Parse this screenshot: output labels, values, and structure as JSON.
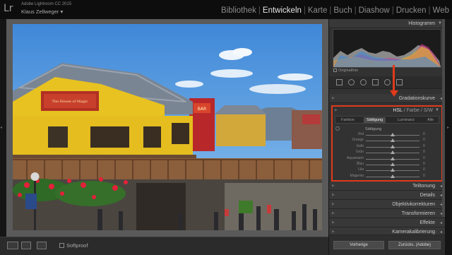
{
  "app": {
    "logo": "Lr",
    "name": "Adobe Lightroom CC 2015",
    "user": "Klaus Zellweger ▾"
  },
  "modules": [
    {
      "label": "Bibliothek",
      "active": false
    },
    {
      "label": "Entwickeln",
      "active": true
    },
    {
      "label": "Karte",
      "active": false
    },
    {
      "label": "Buch",
      "active": false
    },
    {
      "label": "Diashow",
      "active": false
    },
    {
      "label": "Drucken",
      "active": false
    },
    {
      "label": "Web",
      "active": false
    }
  ],
  "photo_signs": {
    "cafe": "The House of Magic",
    "bar": "BAR"
  },
  "toolbar": {
    "softproof_label": "Softproof"
  },
  "panels": {
    "histogram": {
      "title": "Histogramm",
      "info_left": "ISO 400",
      "info_right": "f/5",
      "original_photo_label": "Originalfoto"
    },
    "basic_title": "Gradationskurve",
    "hsl": {
      "tabs": [
        "HSL",
        "Farbe",
        "S/W"
      ],
      "subtabs": [
        "Farbton",
        "Sättigung",
        "Luminanz",
        "Alle"
      ],
      "active_subtab": "Sättigung",
      "section_label": "Sättigung",
      "rows": [
        {
          "name": "Rot",
          "value": "0"
        },
        {
          "name": "Orange",
          "value": "0"
        },
        {
          "name": "Gelb",
          "value": "0"
        },
        {
          "name": "Grün",
          "value": "0"
        },
        {
          "name": "Aquamarin",
          "value": "0"
        },
        {
          "name": "Blau",
          "value": "0"
        },
        {
          "name": "Lila",
          "value": "0"
        },
        {
          "name": "Magenta",
          "value": "0"
        }
      ]
    },
    "lower": [
      "Teiltonung",
      "Details",
      "Objektivkorrekturen",
      "Transformieren",
      "Effekte",
      "Kamerakalibrierung"
    ]
  },
  "buttons": {
    "previous": "Vorherige",
    "reset": "Zurücks. (Adobe)"
  },
  "colors": {
    "highlight": "#e03a1a",
    "sky": "#4f98e0",
    "building_yellow": "#e8c220"
  }
}
